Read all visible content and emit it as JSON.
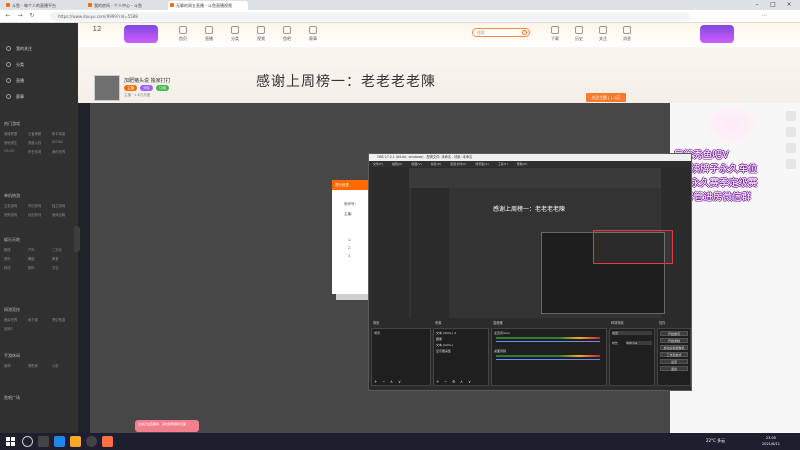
{
  "browser": {
    "tabs": [
      {
        "label": "斗鱼 - 每个人的直播平台"
      },
      {
        "label": "我的房间 - 个人中心 - 斗鱼"
      },
      {
        "label": "无聊的周五直播 - 斗鱼直播视频"
      }
    ],
    "url": "https://www.douyu.com/9999?rid=5588"
  },
  "sidebar": {
    "top_items": [
      {
        "label": "我的关注"
      },
      {
        "label": "分类"
      },
      {
        "label": "直播"
      },
      {
        "label": "赛事"
      }
    ],
    "sections": [
      {
        "title": "热门游戏",
        "items": [
          "英雄联盟",
          "王者荣耀",
          "和平精英",
          "绝地求生",
          "穿越火线",
          "DOTA2",
          "CS:GO",
          "炉石传说",
          "我的世界"
        ]
      },
      {
        "title": "单机热游",
        "items": [
          "主机游戏",
          "怀旧游戏",
          "独立游戏",
          "恐怖游戏",
          "仙剑系列",
          "使命召唤"
        ]
      },
      {
        "title": "娱乐天地",
        "items": [
          "颜值",
          "户外",
          "二次元",
          "音乐",
          "舞蹈",
          "美食",
          "科技",
          "数码",
          "文化"
        ]
      },
      {
        "title": "网游竞技",
        "items": [
          "魔兽世界",
          "地下城",
          "梦幻西游",
          "剑网3"
        ]
      },
      {
        "title": "手游休闲",
        "items": [
          "原神",
          "阴阳师",
          "火影"
        ]
      },
      {
        "title": "鱼吧广场",
        "items": []
      }
    ]
  },
  "header": {
    "nav_items": [
      {
        "label": "首页"
      },
      {
        "label": "直播"
      },
      {
        "label": "分类"
      },
      {
        "label": "视频"
      },
      {
        "label": "鱼吧"
      },
      {
        "label": "赛事"
      }
    ],
    "search_placeholder": "搜索",
    "right_items": [
      {
        "label": "下载"
      },
      {
        "label": "历史"
      },
      {
        "label": "关注"
      },
      {
        "label": "消息"
      }
    ]
  },
  "room": {
    "title": "加肥猪头说 独家打打",
    "overlay_title": "感谢上周榜一：老老老老陳",
    "meta": "主播 · 1.6万热度",
    "follow_label": "关注主播 | 1.3万",
    "tags": [
      "主播",
      "分区",
      "订阅"
    ]
  },
  "player": {
    "popup_header": "提示信息",
    "popup_lines": [
      "房间号:",
      "主播:",
      "1.",
      "2.",
      "3."
    ]
  },
  "danmu": [
    "房管秀鱼吧V",
    "飞机卡牌续牌子永久车位",
    "火箭房管永久赛季定级赛",
    "8级牌子或者房管进房微信群"
  ],
  "obs": {
    "title": "OBS 27.2.1 (64-bit, windows) - 配置文件: 未命名 - 场景: 未命名",
    "menu": [
      "文件(F)",
      "编辑(E)",
      "视图(V)",
      "停靠(D)",
      "配置文件(P)",
      "场景集(S)",
      "工具(T)",
      "帮助(H)"
    ],
    "preview_caption": "感谢上周榜一：老老老老陳",
    "dock_tabs": [
      "场景",
      "来源",
      "混音器",
      "转场特效",
      "控件"
    ],
    "scenes": [
      "场景"
    ],
    "sources": [
      "文本 (GDI+) 2",
      "图像",
      "文本 (GDI+)",
      "显示器采集"
    ],
    "mixer": [
      {
        "name": "麦克风/Aux"
      },
      {
        "name": "桌面音频"
      }
    ],
    "transition": {
      "type": "淡出",
      "duration_label": "时长",
      "duration": "300 ms"
    },
    "controls": [
      "开始推流",
      "开始录制",
      "启动虚拟摄像机",
      "工作室模式",
      "设置",
      "退出"
    ]
  },
  "bottom_notice": "主播正在直播中，请勿频繁刷新页面",
  "taskbar": {
    "tray": "22°C 多云",
    "time": "23:00",
    "date": "2021/6/11"
  }
}
